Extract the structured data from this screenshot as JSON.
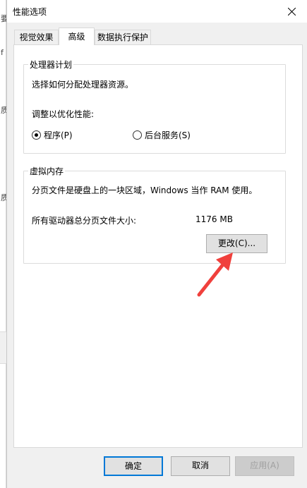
{
  "background": {
    "marks": [
      "要",
      "f",
      "质",
      "质"
    ]
  },
  "window": {
    "title": "性能选项",
    "close_icon": "close-icon"
  },
  "tabs": [
    {
      "label": "视觉效果",
      "active": false
    },
    {
      "label": "高级",
      "active": true
    },
    {
      "label": "数据执行保护",
      "active": false
    }
  ],
  "processor": {
    "title": "处理器计划",
    "description": "选择如何分配处理器资源。",
    "adjust_label": "调整以优化性能:",
    "options": [
      {
        "label": "程序(P)",
        "checked": true
      },
      {
        "label": "后台服务(S)",
        "checked": false
      }
    ]
  },
  "virtual_memory": {
    "title": "虚拟内存",
    "description": "分页文件是硬盘上的一块区域，Windows 当作 RAM 使用。",
    "total_label": "所有驱动器总分页文件大小:",
    "total_value": "1176 MB",
    "change_button": "更改(C)..."
  },
  "footer": {
    "ok": "确定",
    "cancel": "取消",
    "apply": "应用(A)"
  },
  "colors": {
    "arrow": "#f0403c",
    "accent": "#0078d7"
  }
}
